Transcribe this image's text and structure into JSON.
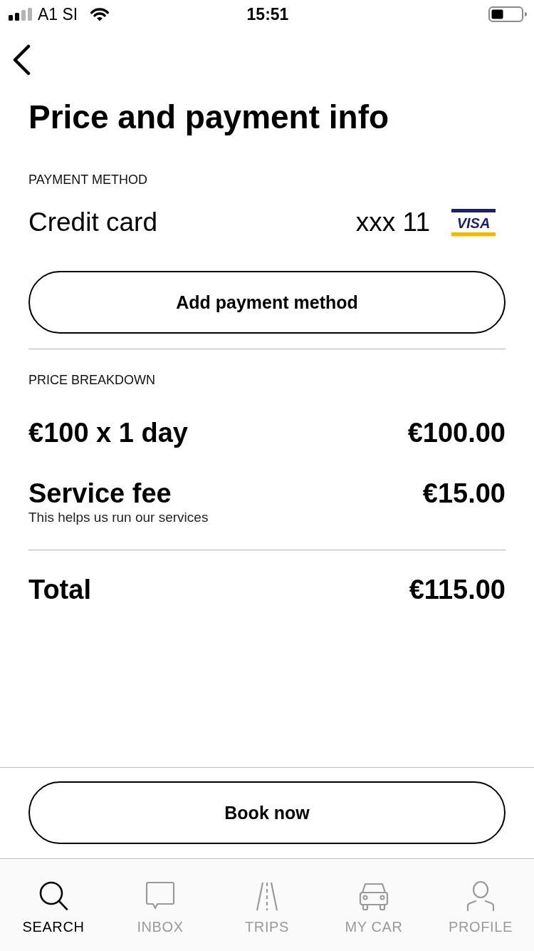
{
  "status_bar": {
    "carrier": "A1 SI",
    "time": "15:51"
  },
  "title": "Price and payment info",
  "payment_method": {
    "label": "PAYMENT METHOD",
    "method": "Credit card",
    "card_number": "xxx 11",
    "card_logo": "VISA",
    "add_button": "Add payment method"
  },
  "price_breakdown": {
    "label": "PRICE BREAKDOWN",
    "items": [
      {
        "label": "€100 x 1 day",
        "amount": "€100.00"
      },
      {
        "label": "Service fee",
        "note": "This helps us run our services",
        "amount": "€15.00"
      }
    ],
    "total": {
      "label": "Total",
      "amount": "€115.00"
    }
  },
  "book_button": "Book now",
  "tab_bar": [
    {
      "label": "SEARCH",
      "selected": true
    },
    {
      "label": "INBOX",
      "selected": false
    },
    {
      "label": "TRIPS",
      "selected": false
    },
    {
      "label": "MY CAR",
      "selected": false
    },
    {
      "label": "PROFILE",
      "selected": false
    }
  ]
}
